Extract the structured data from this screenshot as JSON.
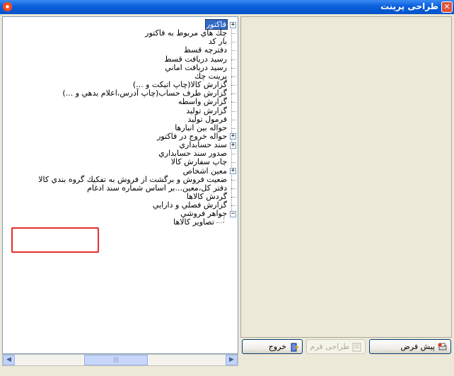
{
  "window": {
    "title": "طراحی پرینت"
  },
  "tree": {
    "items": [
      {
        "label": "فاکتور",
        "expander": "+",
        "selected": true
      },
      {
        "label": "چك هاي مربوط به فاكتور"
      },
      {
        "label": "بار كد"
      },
      {
        "label": "دفترچه قسط"
      },
      {
        "label": "رسيد دريافت قسط"
      },
      {
        "label": "رسيد دريافت اماني"
      },
      {
        "label": "پرينت چك"
      },
      {
        "label": "گزارش كالا(چاپ اتيكت و ...)"
      },
      {
        "label": "گزارش طرف حساب(چاپ آدرس،اعلام بدهي و ...)"
      },
      {
        "label": "گزارش واسطه"
      },
      {
        "label": "گزارش توليد"
      },
      {
        "label": "فرمول توليد"
      },
      {
        "label": "حواله بين انبارها"
      },
      {
        "label": "حواله خروج در فاكتور",
        "expander": "+"
      },
      {
        "label": "سند حسابداري",
        "expander": "+"
      },
      {
        "label": "صدور سند حسابداري"
      },
      {
        "label": "چاپ سفارش كالا"
      },
      {
        "label": "معين اشخاص",
        "expander": "+"
      },
      {
        "label": "ضعيت فروش و برگشت از فروش به تفكيك گروه بندي كالا"
      },
      {
        "label": "دفتر كل،معين...بر اساس شماره سند ادغام"
      },
      {
        "label": "گردش كالاها"
      },
      {
        "label": "گزارش فصلي و دارايي"
      },
      {
        "label": "جواهر فروشي",
        "expander": "−"
      },
      {
        "label": "تصاوير كالاها",
        "child": true
      }
    ]
  },
  "buttons": {
    "preview": "پیش فرض",
    "design_form": "طراحی فرم",
    "exit": "خروج"
  },
  "colors": {
    "titlebar": "#0a5fdc",
    "selection": "#316ac5",
    "highlight": "#e52d2d"
  },
  "icons": {
    "app": "app-icon",
    "close": "close-icon",
    "preview": "print-preview-icon",
    "design": "form-design-icon",
    "exit": "exit-door-icon"
  }
}
